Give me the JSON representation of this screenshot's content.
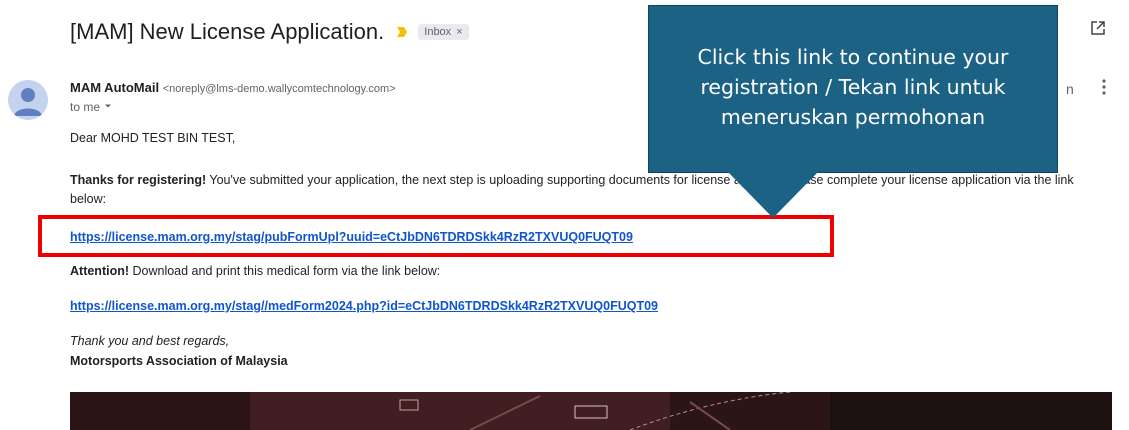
{
  "email": {
    "subject": "[MAM] New License Application.",
    "label": "Inbox",
    "label_close": "×",
    "sender_name": "MAM AutoMail",
    "sender_email": "<noreply@lms-demo.wallycomtechnology.com>",
    "to": "to me",
    "greeting": "Dear MOHD TEST BIN TEST,",
    "intro_bold": "Thanks for registering!",
    "intro_rest": " You've submitted your application, the next step is uploading supporting documents for license approval.Please complete your license application via the link below:",
    "link1": "https://license.mam.org.my/stag/pubFormUpl?uuid=eCtJbDN6TDRDSkk4RzR2TXVUQ0FUQT09",
    "attention_bold": "Attention!",
    "attention_rest": " Download and print this medical form via the link below:",
    "link2": "https://license.mam.org.my/stag//medForm2024.php?id=eCtJbDN6TDRDSkk4RzR2TXVUQ0FUQT09",
    "closing": "Thank you and best regards,",
    "signature": "Motorsports Association of Malaysia",
    "partial_header_char": "n"
  },
  "callout": {
    "line1": "Click this link to continue your",
    "line2": "registration / Tekan link untuk",
    "line3": "meneruskan permohonan"
  },
  "icons": {
    "importance": "importance-marker-icon",
    "print": "print-icon",
    "new_window": "open-in-new-window-icon",
    "avatar": "default-avatar-icon",
    "more": "more-vert-icon",
    "dropdown": "chevron-down-icon"
  },
  "colors": {
    "link": "#1155cc",
    "highlight_border": "#ee0000",
    "callout_bg": "#1c6285",
    "importance": "#f2c200"
  }
}
